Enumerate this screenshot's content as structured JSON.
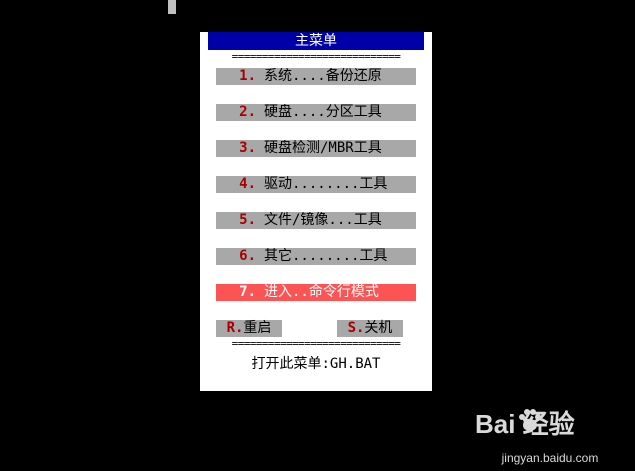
{
  "menu": {
    "title": "主菜单",
    "separator": "============================",
    "items": [
      {
        "key": "1.",
        "label": "系统....备份还原",
        "active": false
      },
      {
        "key": "2.",
        "label": "硬盘....分区工具",
        "active": false
      },
      {
        "key": "3.",
        "label": "硬盘检测/MBR工具",
        "active": false
      },
      {
        "key": "4.",
        "label": "驱动........工具",
        "active": false
      },
      {
        "key": "5.",
        "label": "文件/镜像...工具",
        "active": false
      },
      {
        "key": "6.",
        "label": "其它........工具",
        "active": false
      },
      {
        "key": "7.",
        "label": "进入..命令行模式",
        "active": true
      }
    ],
    "restart": {
      "key": "R.",
      "label": "重启"
    },
    "shutdown": {
      "key": "S.",
      "label": "关机"
    },
    "footer": "打开此菜单:GH.BAT"
  },
  "watermark": {
    "logo": "Bai  经验",
    "url": "jingyan.baidu.com"
  },
  "colors": {
    "background": "#000000",
    "panel": "#ffffff",
    "title_bar": "#0000a8",
    "item_bg": "#a8a8a8",
    "item_key": "#a80000",
    "active_bg": "#fc5454"
  }
}
